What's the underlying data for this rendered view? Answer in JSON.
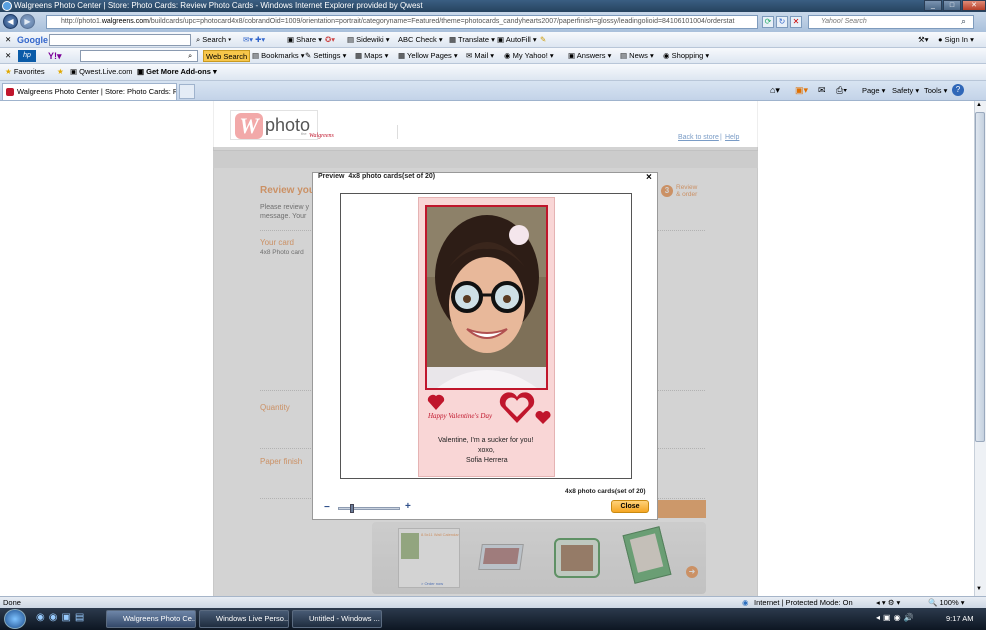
{
  "window": {
    "title": "Walgreens Photo Center | Store: Photo Cards: Review Photo Cards - Windows Internet Explorer provided by Qwest"
  },
  "address_bar": {
    "url_prefix": "http://photo1.",
    "url_domain": "walgreens.com",
    "url_rest": "/buildcards/upc=photocard4x8/cobrandOid=1009/orientation=portrait/categoryname=Featured/theme=photocards_candyhearts2007/paperfinish=glossy/leadingolioid=84106101004/orderstat"
  },
  "search_box": {
    "placeholder": "Yahoo! Search"
  },
  "google_toolbar": {
    "logo": "Google",
    "search_label": "Search",
    "share_label": "Share",
    "sidewiki_label": "Sidewiki",
    "check_label": "Check",
    "translate_label": "Translate",
    "autofill_label": "AutoFill",
    "signin_label": "Sign In"
  },
  "yahoo_toolbar": {
    "web_search_label": "Web Search",
    "bookmarks_label": "Bookmarks",
    "settings_label": "Settings",
    "maps_label": "Maps",
    "yellow_pages_label": "Yellow Pages",
    "mail_label": "Mail",
    "my_yahoo_label": "My Yahoo!",
    "answers_label": "Answers",
    "news_label": "News",
    "shopping_label": "Shopping"
  },
  "favorites_bar": {
    "favorites_label": "Favorites",
    "qwest_label": "Qwest.Live.com",
    "addons_label": "Get More Add-ons"
  },
  "tab": {
    "title": "Walgreens Photo Center | Store: Photo Cards: Rev..."
  },
  "command_bar": {
    "page_label": "Page",
    "safety_label": "Safety",
    "tools_label": "Tools"
  },
  "page": {
    "logo_text": "photo",
    "logo_letter": "W",
    "logo_brand": "Walgreens",
    "logo_the": "the",
    "back_to_store": "Back to store",
    "separator": " | ",
    "help": "Help",
    "step_number": "3",
    "step_label_1": "Review",
    "step_label_2": "& order",
    "heading": "Review you",
    "intro_1": "Please review y",
    "intro_2": "message. Your",
    "your_card_label": "Your card",
    "product_label": "4x8 Photo card",
    "quantity_label": "Quantity",
    "paper_finish_label": "Paper finish"
  },
  "dialog": {
    "title": "Preview  4x8 photo cards(set of 20)",
    "close_x": "×",
    "caption": "4x8 photo cards(set of 20)",
    "close_button": "Close",
    "zoom_out": "−",
    "zoom_in": "+",
    "zoom_level": 0.2
  },
  "card": {
    "headline": "Happy Valentine's Day",
    "message_line_1": "Valentine, I'm a sucker for you!",
    "message_line_2": "xoxo,",
    "message_line_3": "Sofia Herrera"
  },
  "promo": {
    "calendar_title": "8.5x11 Wall Calendar",
    "calendar_link": "> Order now"
  },
  "status_bar": {
    "left": "Done",
    "zone": "Internet | Protected Mode: On",
    "zoom": "100%"
  },
  "taskbar": {
    "task_1": "Walgreens Photo Ce...",
    "task_2": "Windows Live Perso...",
    "task_3": "Untitled - Windows ...",
    "clock": "9:17 AM"
  },
  "colors": {
    "walgreens_red": "#c0162c",
    "accent_orange": "#f39a57",
    "card_pink": "#f9d6d6",
    "close_button": "#f5a623"
  }
}
